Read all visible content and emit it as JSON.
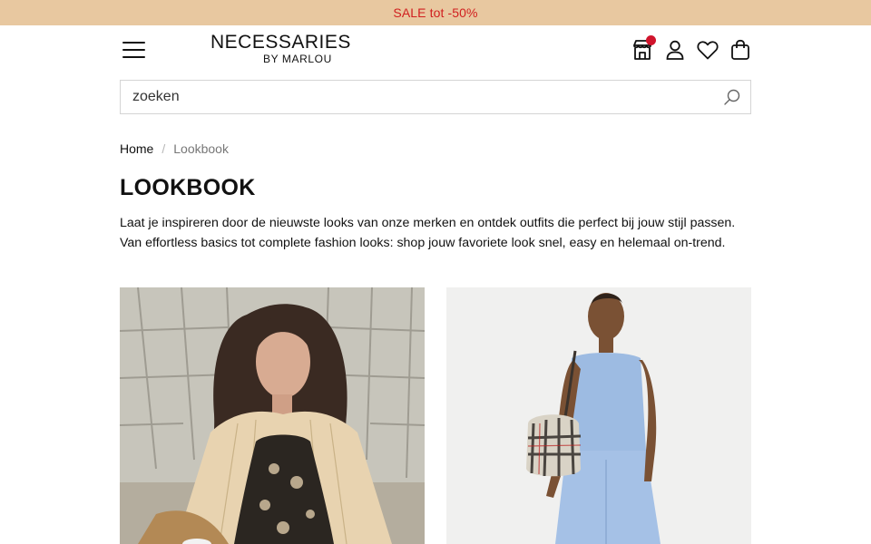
{
  "announcement": {
    "text": "SALE tot -50%"
  },
  "header": {
    "logo_line1": "NECESSARIES",
    "logo_line2": "BY MARLOU",
    "icons": [
      "menu-icon",
      "store-icon",
      "account-icon",
      "heart-icon",
      "bag-icon"
    ]
  },
  "search": {
    "placeholder": "zoeken",
    "value": ""
  },
  "breadcrumb": {
    "home": "Home",
    "separator": "/",
    "current": "Lookbook"
  },
  "page": {
    "title": "LOOKBOOK",
    "intro_line1": "Laat je inspireren door de nieuwste looks van onze merken en ontdek outfits die perfect bij jouw stijl",
    "intro_line2": "passen. Van effortless basics tot complete fashion looks: shop jouw favoriete look snel, easy en",
    "intro_line3": "helemaal on-trend."
  },
  "colors": {
    "sale_bar": "#e8c8a0",
    "sale_text": "#d12020",
    "notification_dot": "#d0142c"
  }
}
